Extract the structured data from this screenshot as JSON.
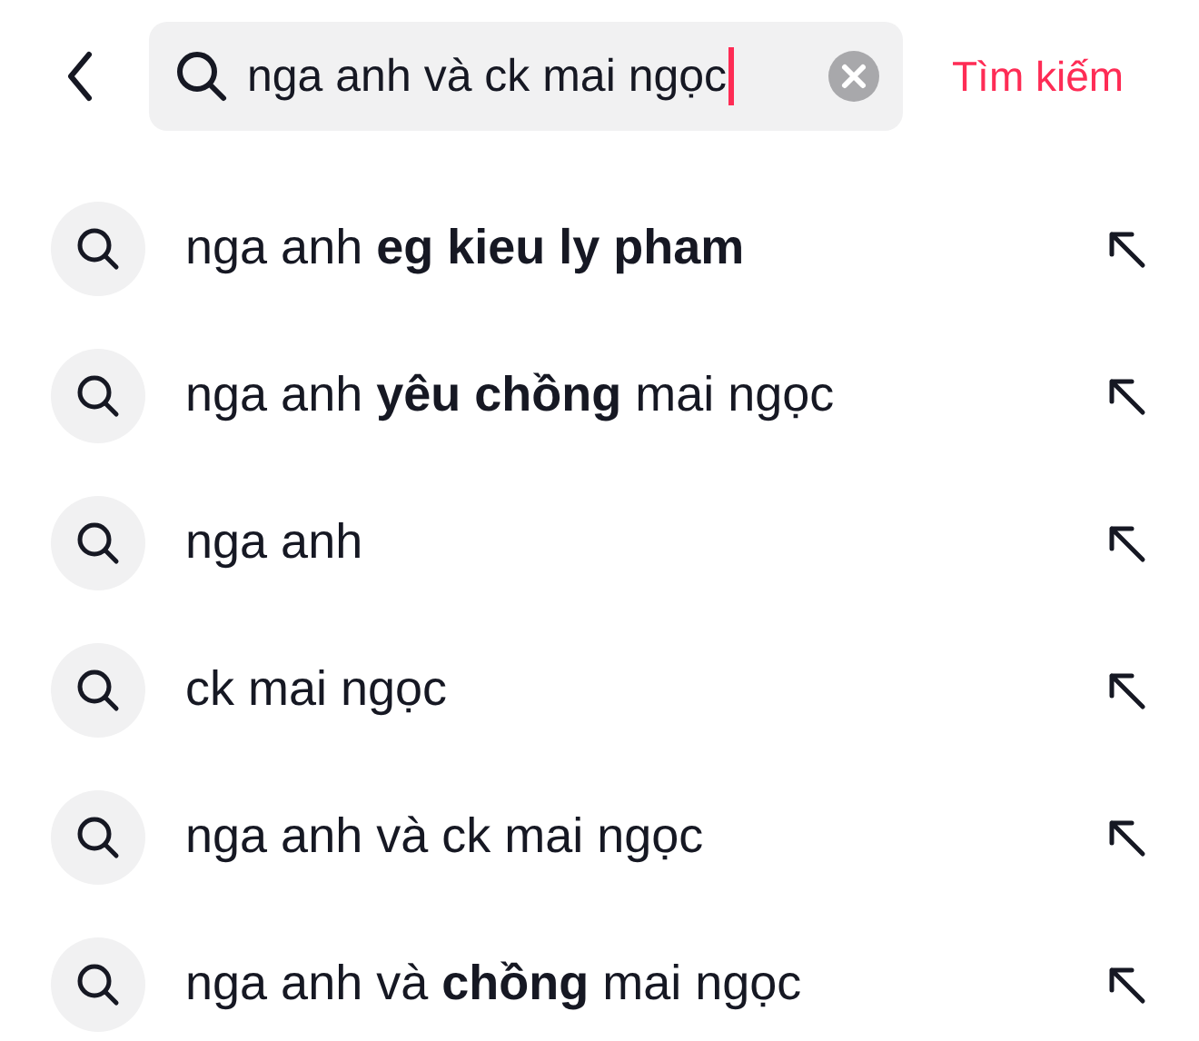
{
  "search": {
    "value": "nga anh và ck mai ngọc",
    "focused": true
  },
  "search_button": "Tìm kiếm",
  "suggestions": [
    {
      "text": "nga anh **eg kieu ly pham**"
    },
    {
      "text": "nga anh **yêu chồng** mai ngọc"
    },
    {
      "text": "nga anh"
    },
    {
      "text": "ck mai ngọc"
    },
    {
      "text": "nga anh và ck mai ngọc"
    },
    {
      "text": "nga anh và **chồng** mai ngọc"
    }
  ]
}
